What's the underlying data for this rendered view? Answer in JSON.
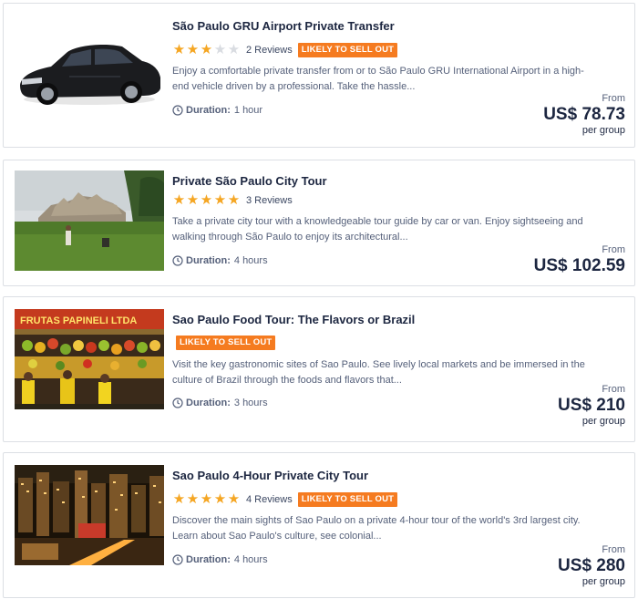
{
  "currency_prefix": "US$",
  "tours": [
    {
      "title": "São Paulo GRU Airport Private Transfer",
      "rating": 3,
      "reviews": "2 Reviews",
      "badge": "LIKELY TO SELL OUT",
      "description": "Enjoy a comfortable private transfer from or to São Paulo GRU International Airport in a high-end vehicle driven by a professional. Take the hassle...",
      "duration_label": "Duration:",
      "duration": "1 hour",
      "from_label": "From",
      "price": "US$ 78.73",
      "per_label": "per group",
      "image": "black-sedan-car"
    },
    {
      "title": "Private São Paulo City Tour",
      "rating": 5,
      "reviews": "3 Reviews",
      "badge": "",
      "description": "Take a private city tour with a knowledgeable tour guide by car or van. Enjoy sightseeing and walking through São Paulo to enjoy its architectural...",
      "duration_label": "Duration:",
      "duration": "4 hours",
      "from_label": "From",
      "price": "US$ 102.59",
      "per_label": "per group",
      "image": "monument-park-photo"
    },
    {
      "title": "Sao Paulo Food Tour: The Flavors or Brazil",
      "rating": 0,
      "reviews": "",
      "badge": "LIKELY TO SELL OUT",
      "description": "Visit the key gastronomic sites of Sao Paulo. See lively local markets and be immersed in the culture of Brazil through the foods and flavors that...",
      "duration_label": "Duration:",
      "duration": "3 hours",
      "from_label": "From",
      "price": "US$ 210",
      "per_label": "per group",
      "image": "fruit-market-stall-photo",
      "image_sign_text": "FRUTAS PAPINELI LTDA"
    },
    {
      "title": "Sao Paulo 4-Hour Private City Tour",
      "rating": 5,
      "reviews": "4 Reviews",
      "badge": "LIKELY TO SELL OUT",
      "description": "Discover the main sights of Sao Paulo on a private 4-hour tour of the world's 3rd largest city. Learn about Sao Paulo's culture, see colonial...",
      "duration_label": "Duration:",
      "duration": "4 hours",
      "from_label": "From",
      "price": "US$ 280",
      "per_label": "per group",
      "image": "night-city-skyline-photo"
    }
  ],
  "colors": {
    "star_on": "#f5a623",
    "star_off": "#d9dce1",
    "badge_bg": "#f57b20",
    "title": "#1c2640",
    "body_text": "#55607a"
  }
}
